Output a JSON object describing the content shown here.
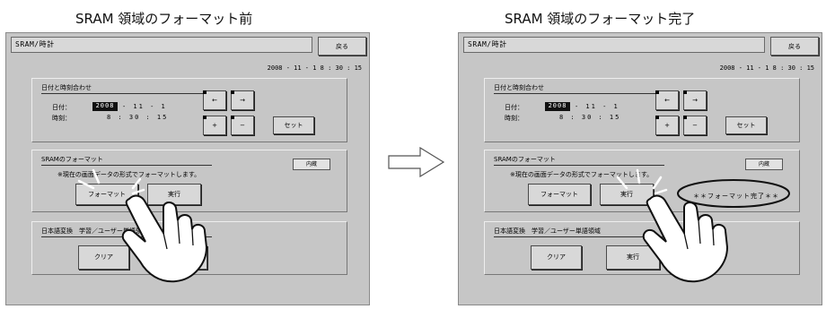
{
  "captions": {
    "before": "SRAM 領域のフォーマット前",
    "after": "SRAM 領域のフォーマット完了"
  },
  "screen": {
    "title": "SRAM/時計",
    "back_label": "戻る",
    "datetime": "2008 - 11 - 1   8 : 30 : 15",
    "clock_panel": {
      "title": "日付と時刻合わせ",
      "date_label": "日付：",
      "year": "2008",
      "date_rest": "- 11 - 1",
      "time_label": "時刻：",
      "time_value": "8 : 30 : 15",
      "left_arrow": "←",
      "right_arrow": "→",
      "plus": "+",
      "minus": "−",
      "set_label": "セット"
    },
    "format_panel": {
      "title": "SRAMのフォーマット",
      "internal_label": "内蔵",
      "note": "※現在の画面データの形式でフォーマットします。",
      "format_label": "フォーマット",
      "execute_label": "実行",
      "complete_message": "＊＊フォーマット完了＊＊"
    },
    "dict_panel": {
      "title": "日本語変換　学習／ユーザー単語領域",
      "clear_label": "クリア",
      "execute_label": "実行"
    }
  }
}
